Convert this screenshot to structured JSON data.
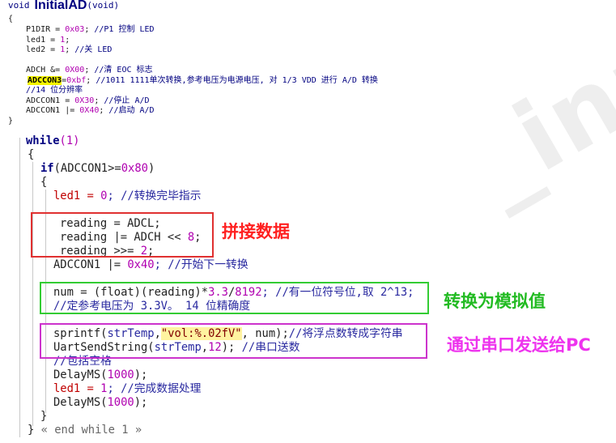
{
  "header": {
    "void_kw": "void",
    "function_name": "InitialAD",
    "params": "(void)"
  },
  "top_code": {
    "brace_open": "{",
    "lines": [
      {
        "a": "  P1DIR = ",
        "num": "0x03",
        "b": "; ",
        "cmt": "//P1 控制 LED"
      },
      {
        "a": "  led1 = ",
        "num": "1",
        "b": ";",
        "cmt": ""
      },
      {
        "a": "  led2 = ",
        "num": "1",
        "b": "; ",
        "cmt": "//关 LED"
      },
      {
        "a": "",
        "num": "",
        "b": "",
        "cmt": ""
      },
      {
        "a": "  ADCH &= ",
        "num": "0X00",
        "b": "; ",
        "cmt": "//清 EOC 标志"
      },
      {
        "hl": "ADCCON3",
        "a": "=",
        "num": "0xbf",
        "b": "; ",
        "cmt": "//1011 1111单次转换,参考电压为电源电压, 对 1/3 VDD 进行 A/D 转换"
      },
      {
        "a": "  ",
        "num": "",
        "b": "",
        "cmt": "//14 位分辨率"
      },
      {
        "a": "  ADCCON1 = ",
        "num": "0X30",
        "b": "; ",
        "cmt": "//停止 A/D"
      },
      {
        "a": "  ADCCON1 |= ",
        "num": "0X40",
        "b": "; ",
        "cmt": "//启动 A/D"
      }
    ],
    "brace_close": "}"
  },
  "code": {
    "while_kw": "while",
    "while_arg": "(1)",
    "brace1": "{",
    "if_kw": "if",
    "if_cond": "(ADCCON1>=",
    "if_num": "0x80",
    "if_close": ")",
    "brace2": "{",
    "led1_a": "led1 = ",
    "led1_num": "0",
    "led1_cmt": "; //转换完毕指示",
    "reading1": "reading = ADCL;",
    "reading2_a": "reading |= ADCH << ",
    "reading2_num": "8",
    "reading2_b": ";",
    "reading3_a": "reading >>= ",
    "reading3_num": "2",
    "reading3_b": ";",
    "adccon_a": "ADCCON1 |= ",
    "adccon_num": "0x40",
    "adccon_cmt": "; //开始下一转换",
    "num_a": "num = (float)(reading)*",
    "num_n1": "3.3",
    "num_op": "/",
    "num_n2": "8192",
    "num_cmt": "; //有一位符号位,取 2^13;",
    "num_cmt2": "//定参考电压为 3.3V。 14 位精确度",
    "sprintf_a": "sprintf(",
    "sprintf_var": "strTemp",
    "sprintf_comma": ",",
    "sprintf_str": "\"vol:%.02fV\"",
    "sprintf_b": ", num);",
    "sprintf_cmt": "//将浮点数转成字符串",
    "uart_a": "UartSendString(",
    "uart_var": "strTemp",
    "uart_comma": ",",
    "uart_num": "12",
    "uart_b": "); ",
    "uart_cmt": "//串口送数",
    "pkg_cmt": "//包括空格",
    "delay1_a": "DelayMS(",
    "delay1_num": "1000",
    "delay1_b": ");",
    "led1b_a": "led1 = ",
    "led1b_num": "1",
    "led1b_cmt": "; //完成数据处理",
    "delay2_a": "DelayMS(",
    "delay2_num": "1000",
    "delay2_b": ");",
    "brace2_close": "}",
    "brace1_close": "}",
    "end_while": " « end while 1 »"
  },
  "annotations": {
    "splice": "拼接数据",
    "convert": "转换为模拟值",
    "send": "通过串口发送给PC"
  },
  "watermark": "_inux",
  "colors": {
    "red_box": "#e03030",
    "green_box": "#33cc33",
    "magenta_box": "#cc33cc",
    "splice_text": "#ff2020",
    "convert_text": "#22bb22",
    "send_text": "#ee33ee"
  }
}
